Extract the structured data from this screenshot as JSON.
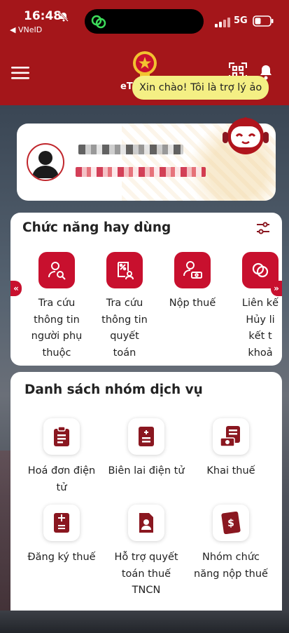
{
  "status_bar": {
    "time": "16:48",
    "back_app": "◀ VNeID",
    "network": "5G"
  },
  "header": {
    "brand": "eT",
    "greeting": "Xin chào! Tôi là trợ lý ảo"
  },
  "frequent": {
    "title": "Chức năng hay dùng",
    "items": [
      {
        "label": "Tra cứu\nthông tin\nngười phụ\nthuộc",
        "icon": "user-search-icon"
      },
      {
        "label": "Tra cứu\nthông tin\nquyết\ntoán",
        "icon": "document-percent-icon"
      },
      {
        "label": "Nộp thuế",
        "icon": "user-money-icon"
      },
      {
        "label": "Liên kế\nHủy li\nkết t\nkhoả",
        "icon": "link-icon"
      }
    ]
  },
  "services": {
    "title": "Danh sách nhóm dịch vụ",
    "items": [
      {
        "label": "Hoá đơn điện\ntử",
        "icon": "clipboard-icon"
      },
      {
        "label": "Biên lai điện tử",
        "icon": "receipt-icon"
      },
      {
        "label": "Khai thuế",
        "icon": "tax-declare-icon"
      },
      {
        "label": "Đăng ký thuế",
        "icon": "calculator-doc-icon"
      },
      {
        "label": "Hỗ trợ quyết\ntoán thuế\nTNCN",
        "icon": "id-doc-icon"
      },
      {
        "label": "Nhóm chức\nnăng nộp thuế",
        "icon": "money-doc-icon"
      }
    ]
  },
  "colors": {
    "header_red": "#a4161a",
    "accent_red": "#c8102e",
    "dark_red": "#8a1720",
    "greeting_yellow": "#f4ef84"
  }
}
